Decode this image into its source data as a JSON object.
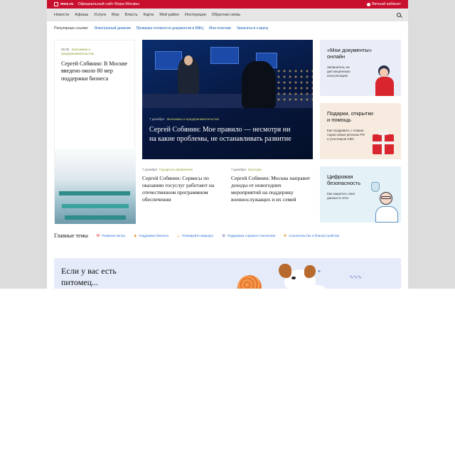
{
  "topbar": {
    "site": "mos.ru",
    "subtitle": "Официальный сайт Мэра Москвы",
    "cabinet": "Личный кабинет"
  },
  "nav": {
    "items": [
      "Новости",
      "Афиша",
      "Услуги",
      "Мэр",
      "Власть",
      "Карта",
      "Мой район",
      "Инструкции",
      "Обратная связь"
    ]
  },
  "popular": {
    "label": "Популярные ссылки:",
    "links": [
      "Электронный дневник",
      "Проверка готовности документов в МФЦ",
      "Мои платежи",
      "Записаться к врачу"
    ]
  },
  "left_news": {
    "date": "06:36",
    "category": "Экономика и предпринимательство",
    "headline": "Сергей Собянин: В Москве введено около 80 мер поддержки бизнеса"
  },
  "big_news": {
    "date": "7 декабря",
    "category": "Экономика и предпринимательство",
    "headline": "Сергей Собянин: Мое правило — несмотря ни на какие проблемы, не останавливать развитие"
  },
  "small_news": [
    {
      "date": "7 декабря",
      "category": "Городское управление",
      "headline": "Сергей Собянин: Сервисы по оказанию госуслуг работают на отечественном программном обеспечении"
    },
    {
      "date": "7 декабря",
      "category": "Культура",
      "headline": "Сергей Собянин: Москва направит доходы от новогодних мероприятий на поддержку военнослужащих и их семей"
    }
  ],
  "promos": [
    {
      "title": "«Мои документы» онлайн",
      "desc": "Запишитесь на дистанционную консультацию",
      "bg": "#e8edf7"
    },
    {
      "title": "Подарки, открытки и помощь",
      "desc": "Как поздравить с Новым годом новые регионы РФ и участников СВО",
      "bg": "#f7ebe0"
    },
    {
      "title": "Цифровая безопасность",
      "desc": "Как защитить свои данные в сети",
      "bg": "#e4f1f7"
    }
  ],
  "topics": {
    "heading": "Главные темы",
    "items": [
      {
        "icon": "metro-icon",
        "label": "Развитие метро"
      },
      {
        "icon": "business-icon",
        "label": "Поддержка бизнеса"
      },
      {
        "icon": "route-icon",
        "label": "Планируйте маршрут"
      },
      {
        "icon": "mask-icon",
        "label": "Поддержка старшего поколения"
      },
      {
        "icon": "build-icon",
        "label": "Строительство и благоустройство"
      }
    ]
  },
  "pet_banner": {
    "title": "Если у вас есть питомец..."
  },
  "colors": {
    "brand": "#c8102e",
    "link": "#1a5fb4",
    "category": "#8a9a2a"
  }
}
